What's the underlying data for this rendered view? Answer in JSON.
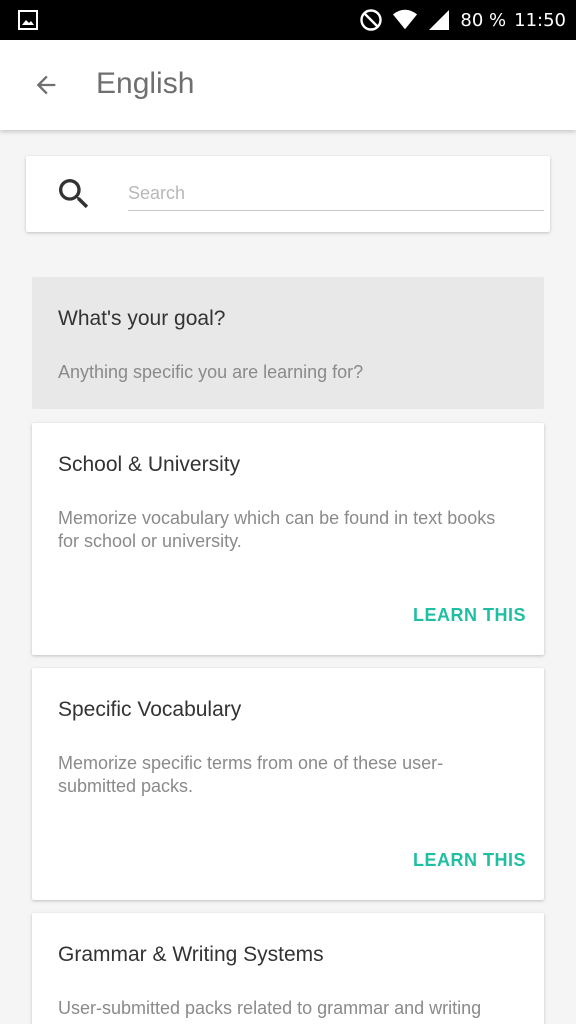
{
  "status_bar": {
    "battery": "80 %",
    "time": "11:50"
  },
  "app_bar": {
    "title": "English"
  },
  "search": {
    "placeholder": "Search",
    "value": ""
  },
  "goal_section": {
    "title": "What's your goal?",
    "subtitle": "Anything specific you are learning for?"
  },
  "cards": [
    {
      "title": "School & University",
      "description": "Memorize vocabulary which can be found in text books for school or university.",
      "action": "LEARN THIS"
    },
    {
      "title": "Specific Vocabulary",
      "description": "Memorize specific terms from one of these user-submitted packs.",
      "action": "LEARN THIS"
    },
    {
      "title": "Grammar & Writing Systems",
      "description": "User-submitted packs related to grammar and writing"
    }
  ],
  "colors": {
    "accent": "#1fbfa3",
    "title_text": "#6f6f6f",
    "background": "#f5f5f5"
  }
}
